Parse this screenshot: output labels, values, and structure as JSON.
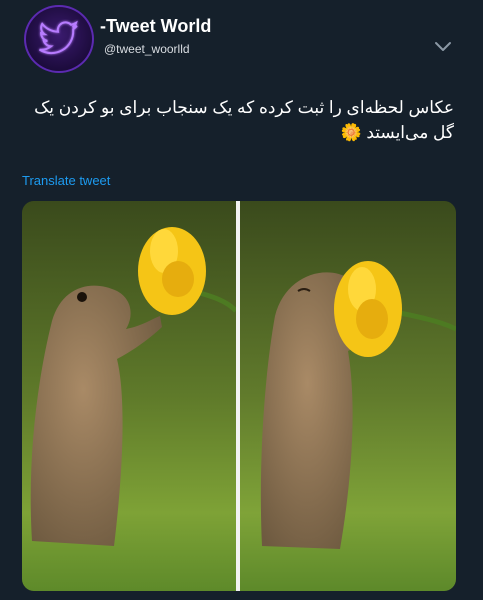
{
  "account": {
    "name": "-Tweet World",
    "handle": "@tweet_woorlld"
  },
  "tweet": {
    "text": "عکاس لحظه‌ای را ثبت کرده که یک سنجاب برای بو کردن یک گل می‌ایستد 🌼",
    "translate_label": "Translate tweet"
  },
  "media": {
    "images": [
      "squirrel-reaching-flower",
      "squirrel-smelling-flower"
    ]
  },
  "icons": {
    "avatar": "twitter-bird-icon",
    "menu": "chevron-down-icon"
  },
  "colors": {
    "background": "#15202b",
    "link": "#1d9bf0",
    "avatar_glow": "#7b3cff"
  }
}
